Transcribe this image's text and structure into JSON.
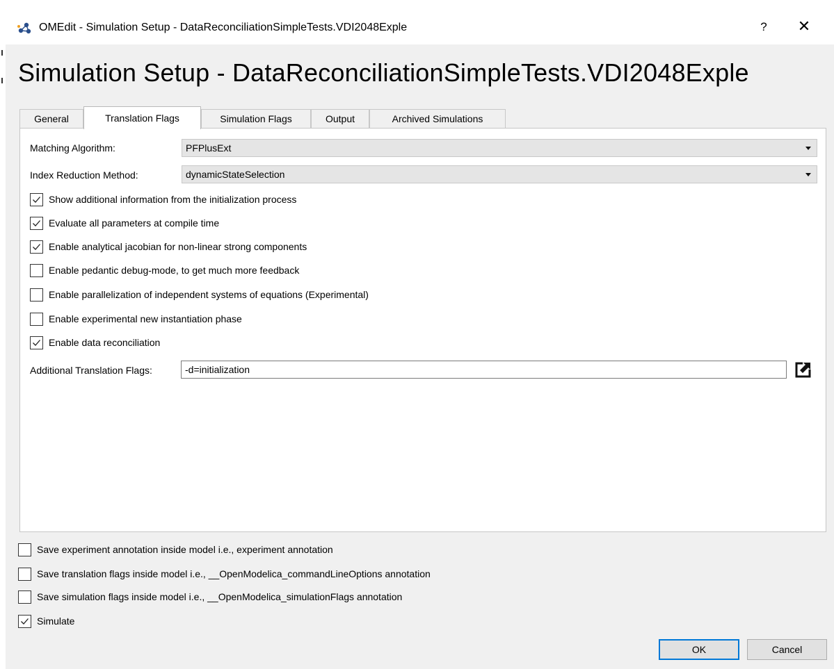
{
  "window": {
    "title": "OMEdit - Simulation Setup - DataReconciliationSimpleTests.VDI2048Exple",
    "help_label": "?",
    "close_label": "✕"
  },
  "heading": "Simulation Setup - DataReconciliationSimpleTests.VDI2048Exple",
  "tabs": [
    {
      "label": "General"
    },
    {
      "label": "Translation Flags"
    },
    {
      "label": "Simulation Flags"
    },
    {
      "label": "Output"
    },
    {
      "label": "Archived Simulations"
    }
  ],
  "active_tab": "Translation Flags",
  "translation_flags": {
    "matching_algorithm": {
      "label": "Matching Algorithm:",
      "value": "PFPlusExt"
    },
    "index_reduction": {
      "label": "Index Reduction Method:",
      "value": "dynamicStateSelection"
    },
    "options": [
      {
        "label": "Show additional information from the initialization process",
        "checked": true
      },
      {
        "label": "Evaluate all parameters at compile time",
        "checked": true
      },
      {
        "label": "Enable analytical jacobian for non-linear strong components",
        "checked": true
      },
      {
        "label": "Enable pedantic debug-mode, to get much more feedback",
        "checked": false
      },
      {
        "label": "Enable parallelization of independent systems of equations (Experimental)",
        "checked": false
      },
      {
        "label": "Enable experimental new instantiation phase",
        "checked": false
      },
      {
        "label": "Enable data reconciliation",
        "checked": true
      }
    ],
    "additional_flags": {
      "label": "Additional Translation Flags:",
      "value": "-d=initialization"
    }
  },
  "bottom_options": [
    {
      "label": "Save experiment annotation inside model i.e., experiment annotation",
      "checked": false
    },
    {
      "label": "Save translation flags inside model i.e., __OpenModelica_commandLineOptions annotation",
      "checked": false
    },
    {
      "label": "Save simulation flags inside model i.e., __OpenModelica_simulationFlags annotation",
      "checked": false
    },
    {
      "label": "Simulate",
      "checked": true
    }
  ],
  "buttons": {
    "ok": "OK",
    "cancel": "Cancel"
  },
  "colors": {
    "accent": "#0078d7",
    "background": "#f0f0f0"
  }
}
